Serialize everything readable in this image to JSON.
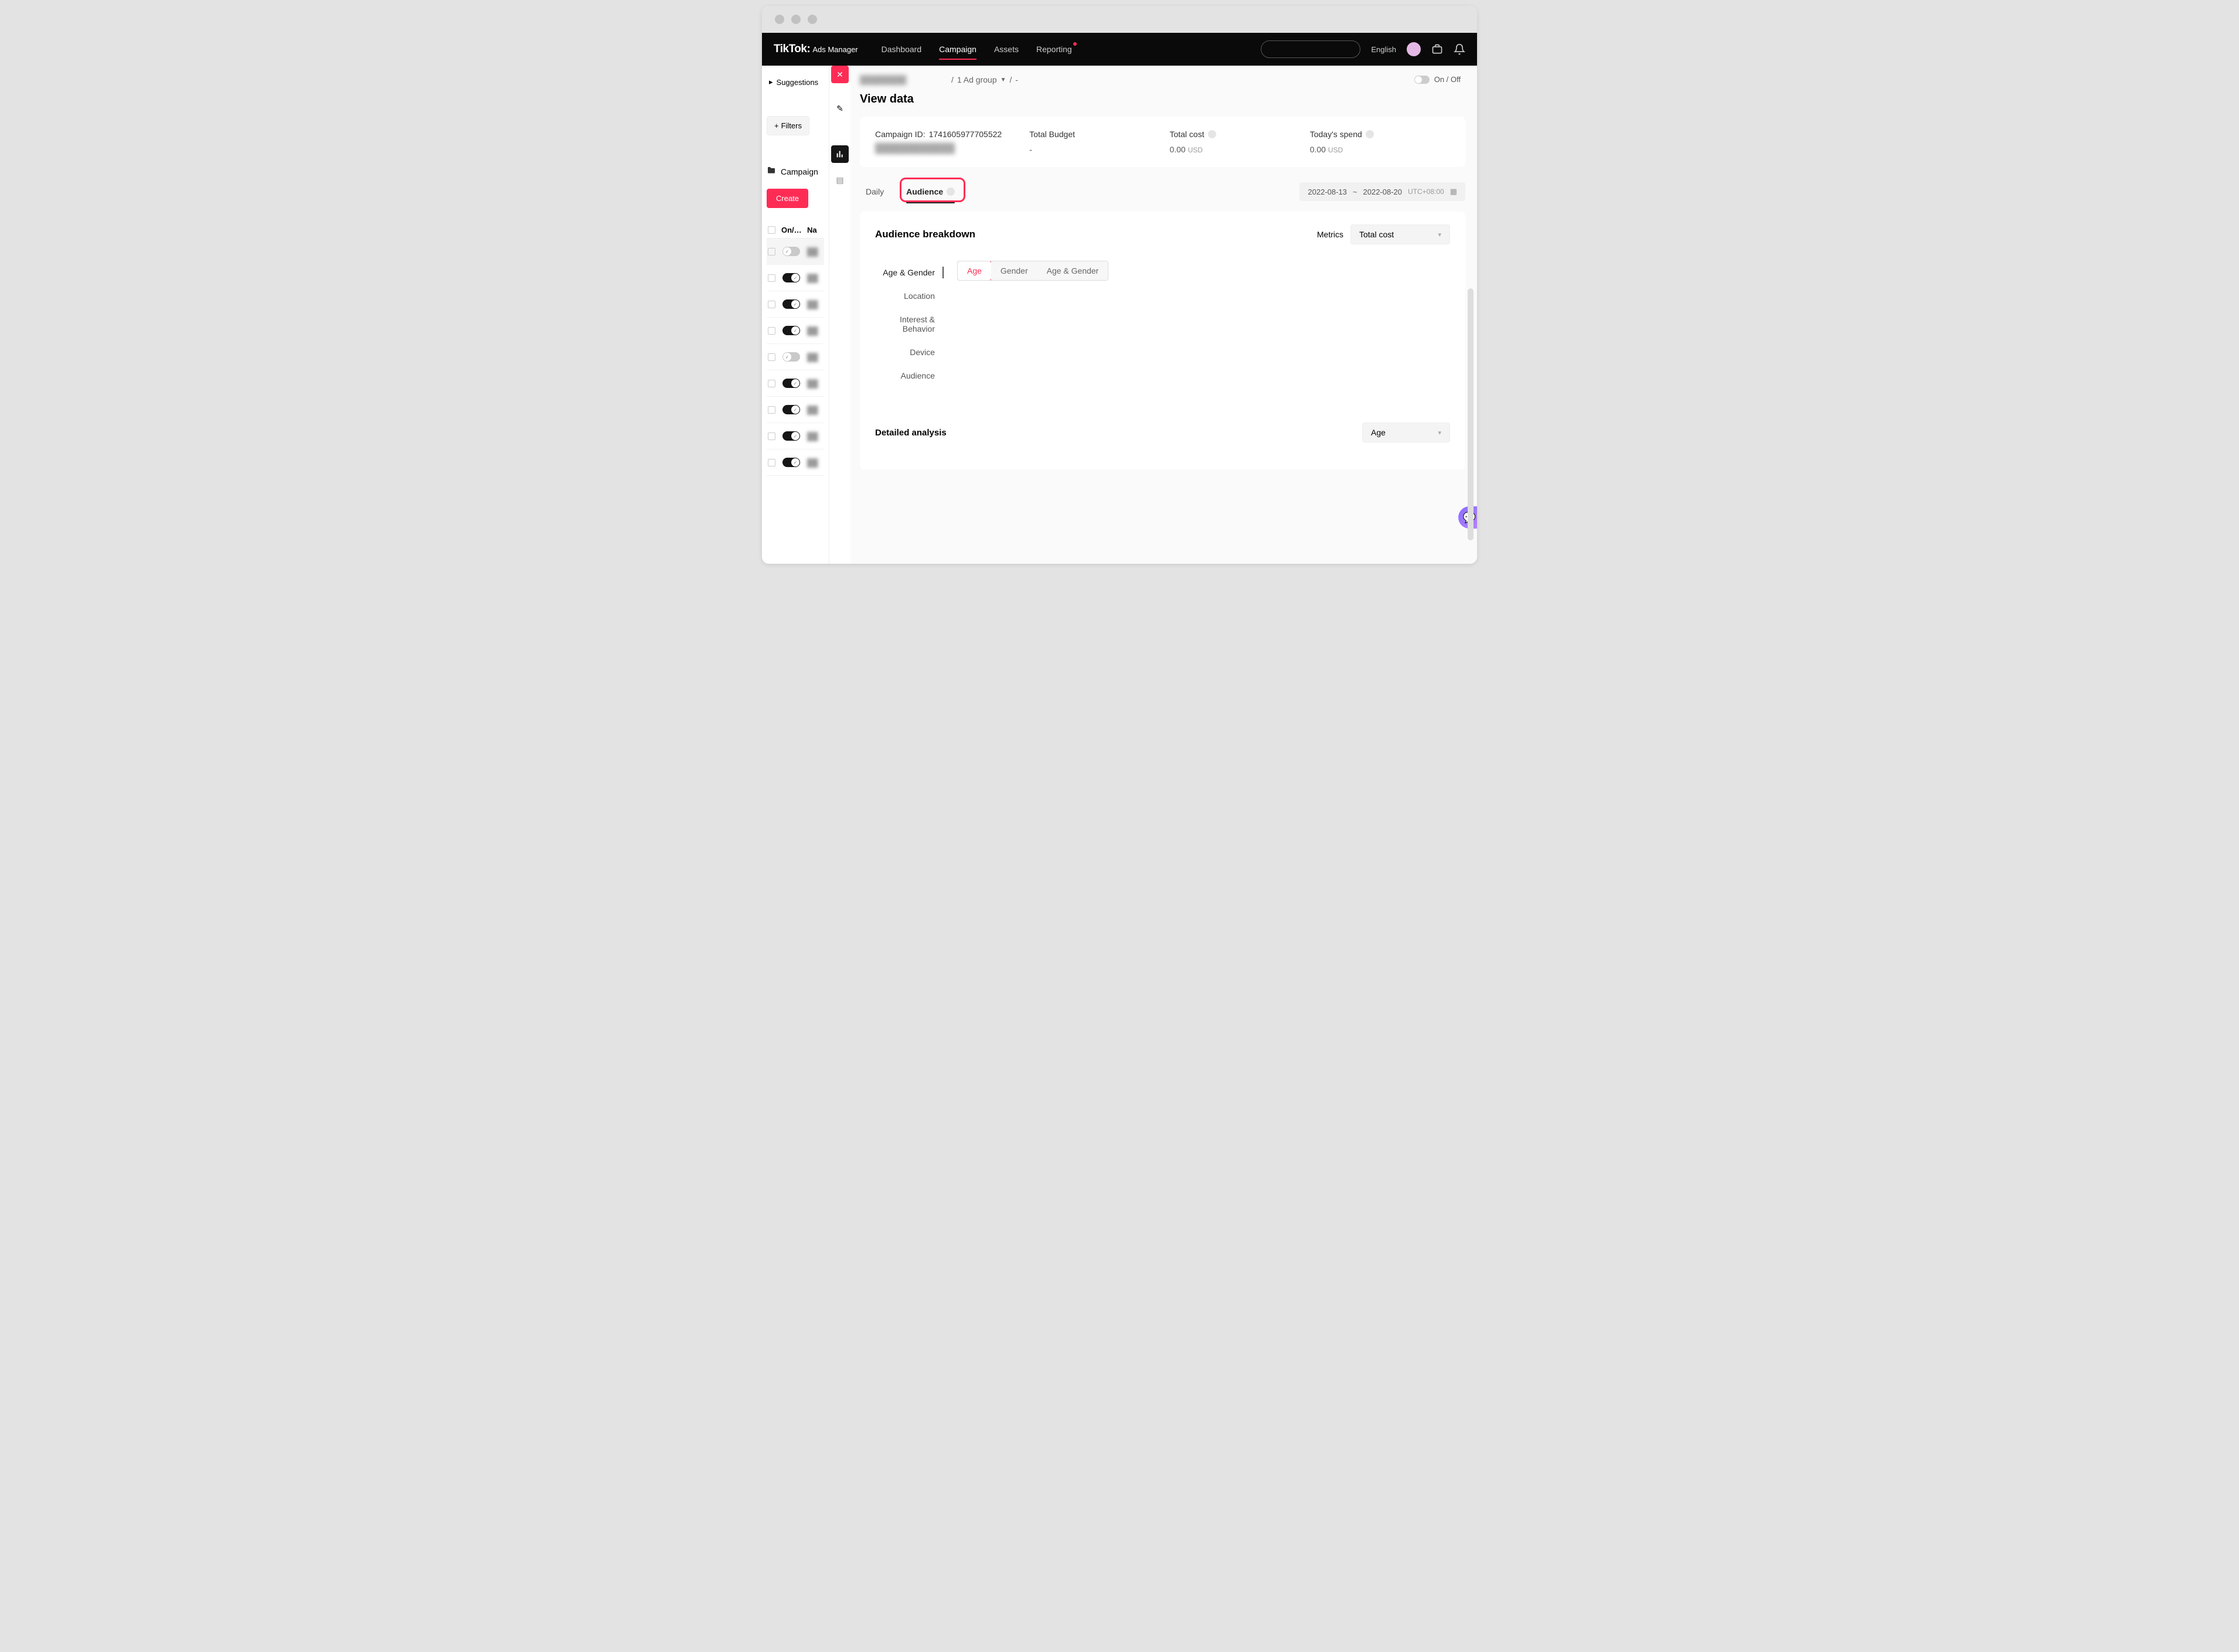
{
  "brand": {
    "name": "TikTok:",
    "sub": "Ads Manager"
  },
  "nav": {
    "dashboard": "Dashboard",
    "campaign": "Campaign",
    "assets": "Assets",
    "reporting": "Reporting"
  },
  "topright": {
    "lang": "English"
  },
  "left": {
    "suggestions": "Suggestions",
    "filters": "Filters",
    "campaign": "Campaign",
    "create": "Create",
    "col_on": "On/…",
    "col_name": "Na",
    "rows": [
      {
        "on": false,
        "sel": true
      },
      {
        "on": true
      },
      {
        "on": true
      },
      {
        "on": true
      },
      {
        "on": false
      },
      {
        "on": true
      },
      {
        "on": true
      },
      {
        "on": true
      },
      {
        "on": true
      }
    ]
  },
  "crumbs": {
    "adgroup": "1 Ad group",
    "dash": "-"
  },
  "onoff": {
    "on": "On",
    "off": "Off"
  },
  "title": "View data",
  "card": {
    "campid_label": "Campaign ID:",
    "campid_value": "1741605977705522",
    "budget_label": "Total Budget",
    "budget_value": "-",
    "cost_label": "Total cost",
    "cost_value": "0.00",
    "cost_cur": "USD",
    "spend_label": "Today's spend",
    "spend_value": "0.00",
    "spend_cur": "USD"
  },
  "tabs": {
    "daily": "Daily",
    "audience": "Audience"
  },
  "daterange": {
    "from": "2022-08-13",
    "sep": "~",
    "to": "2022-08-20",
    "tz": "UTC+08:00"
  },
  "panel": {
    "title": "Audience breakdown",
    "metrics_label": "Metrics",
    "metrics_value": "Total cost",
    "side": {
      "agegender": "Age & Gender",
      "location": "Location",
      "interest": "Interest & Behavior",
      "device": "Device",
      "audience": "Audience"
    },
    "segs": {
      "age": "Age",
      "gender": "Gender",
      "both": "Age & Gender"
    }
  },
  "detail": {
    "title": "Detailed analysis",
    "sel": "Age"
  }
}
